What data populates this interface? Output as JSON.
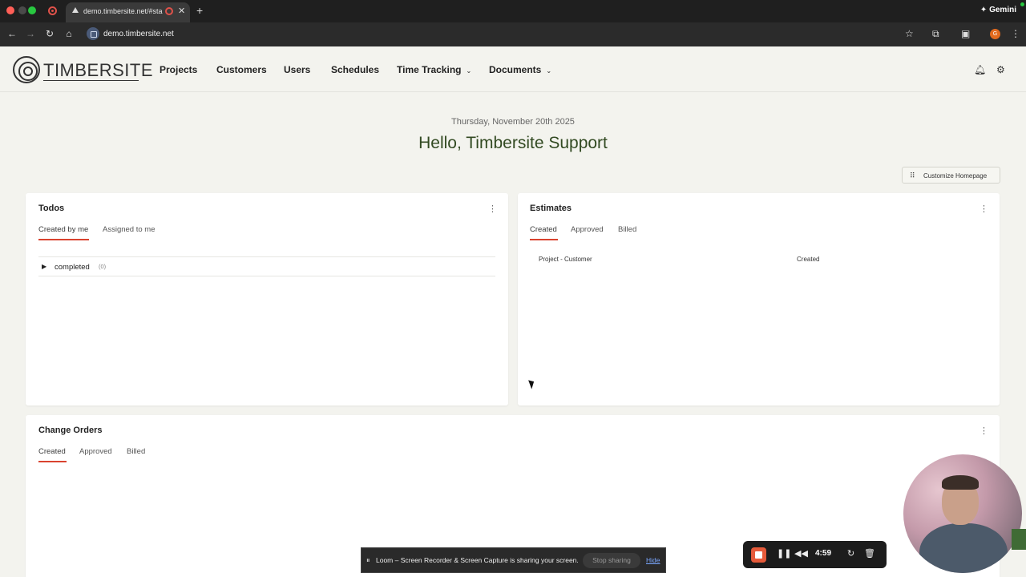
{
  "browser": {
    "tab_title": "demo.timbersite.net/#sta",
    "tab_close": "✕",
    "new_tab": "+",
    "address": "demo.timbersite.net",
    "gemini_label": "Gemini",
    "profile_initial": "G"
  },
  "app": {
    "logo_text": "TIMBERSITE",
    "nav": [
      {
        "label": "Projects"
      },
      {
        "label": "Customers"
      },
      {
        "label": "Users"
      },
      {
        "label": "Schedules"
      },
      {
        "label": "Time Tracking",
        "dropdown": true
      },
      {
        "label": "Documents",
        "dropdown": true
      }
    ]
  },
  "greeting": {
    "date": "Thursday, November 20th 2025",
    "hello": "Hello, Timbersite Support",
    "customize_label": "Customize Homepage"
  },
  "todos": {
    "title": "Todos",
    "tabs": [
      "Created by me",
      "Assigned to me"
    ],
    "active_tab": 0,
    "groups": [
      {
        "label": "completed",
        "count": "(0)"
      }
    ]
  },
  "estimates": {
    "title": "Estimates",
    "tabs": [
      "Created",
      "Approved",
      "Billed"
    ],
    "active_tab": 0,
    "columns": [
      "Project - Customer",
      "Created"
    ]
  },
  "change_orders": {
    "title": "Change Orders",
    "tabs": [
      "Created",
      "Approved",
      "Billed"
    ],
    "active_tab": 0
  },
  "loom": {
    "sharing_text": "Loom – Screen Recorder & Screen Capture is sharing your screen.",
    "stop_label": "Stop sharing",
    "hide_label": "Hide",
    "timer": "4:59"
  },
  "colors": {
    "accent": "#d9432f",
    "greeting": "#324a22",
    "background": "#f3f3ee"
  }
}
